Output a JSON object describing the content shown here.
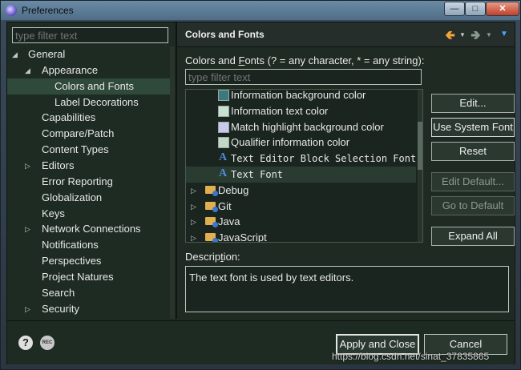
{
  "window": {
    "title": "Preferences"
  },
  "left": {
    "filter_placeholder": "type filter text",
    "tree": [
      {
        "label": "General",
        "level": 0,
        "twisty": "open"
      },
      {
        "label": "Appearance",
        "level": 1,
        "twisty": "open"
      },
      {
        "label": "Colors and Fonts",
        "level": 2,
        "twisty": "none",
        "selected": true
      },
      {
        "label": "Label Decorations",
        "level": 2,
        "twisty": "none"
      },
      {
        "label": "Capabilities",
        "level": 1,
        "twisty": "none"
      },
      {
        "label": "Compare/Patch",
        "level": 1,
        "twisty": "none"
      },
      {
        "label": "Content Types",
        "level": 1,
        "twisty": "none"
      },
      {
        "label": "Editors",
        "level": 1,
        "twisty": "closed"
      },
      {
        "label": "Error Reporting",
        "level": 1,
        "twisty": "none"
      },
      {
        "label": "Globalization",
        "level": 1,
        "twisty": "none"
      },
      {
        "label": "Keys",
        "level": 1,
        "twisty": "none"
      },
      {
        "label": "Network Connections",
        "level": 1,
        "twisty": "closed"
      },
      {
        "label": "Notifications",
        "level": 1,
        "twisty": "none"
      },
      {
        "label": "Perspectives",
        "level": 1,
        "twisty": "none"
      },
      {
        "label": "Project Natures",
        "level": 1,
        "twisty": "none"
      },
      {
        "label": "Search",
        "level": 1,
        "twisty": "none"
      },
      {
        "label": "Security",
        "level": 1,
        "twisty": "closed"
      }
    ]
  },
  "right": {
    "header_title": "Colors and Fonts",
    "cf_label_pre": "Colors and ",
    "cf_label_u": "F",
    "cf_label_post": "onts (? = any character, * = any string):",
    "filter_placeholder": "type filter text",
    "items": [
      {
        "label": "Information background color",
        "kind": "swatch",
        "color": "#3b7a7a"
      },
      {
        "label": "Information text color",
        "kind": "swatch",
        "color": "#c8e0d0"
      },
      {
        "label": "Match highlight background color",
        "kind": "swatch",
        "color": "#c8c8f0"
      },
      {
        "label": "Qualifier information color",
        "kind": "swatch",
        "color": "#c0d8c8"
      },
      {
        "label": "Text Editor Block Selection Font",
        "kind": "font"
      },
      {
        "label": "Text Font",
        "kind": "font",
        "selected": true
      },
      {
        "label": "Debug",
        "kind": "folder"
      },
      {
        "label": "Git",
        "kind": "folder"
      },
      {
        "label": "Java",
        "kind": "folder"
      },
      {
        "label": "JavaScript",
        "kind": "folder"
      }
    ],
    "buttons": {
      "edit": "Edit...",
      "use_system_font": "Use System Font",
      "reset": "Reset",
      "edit_default": "Edit Default...",
      "go_to_default": "Go to Default",
      "expand_all": "Expand All"
    },
    "desc_label_pre": "Descrip",
    "desc_label_u": "t",
    "desc_label_post": "ion:",
    "description": "The text font is used by text editors."
  },
  "bottom": {
    "apply_close": "Apply and Close",
    "cancel": "Cancel",
    "rec_label": "REC"
  },
  "watermark": "https://blog.csdn.net/sinat_37835865"
}
